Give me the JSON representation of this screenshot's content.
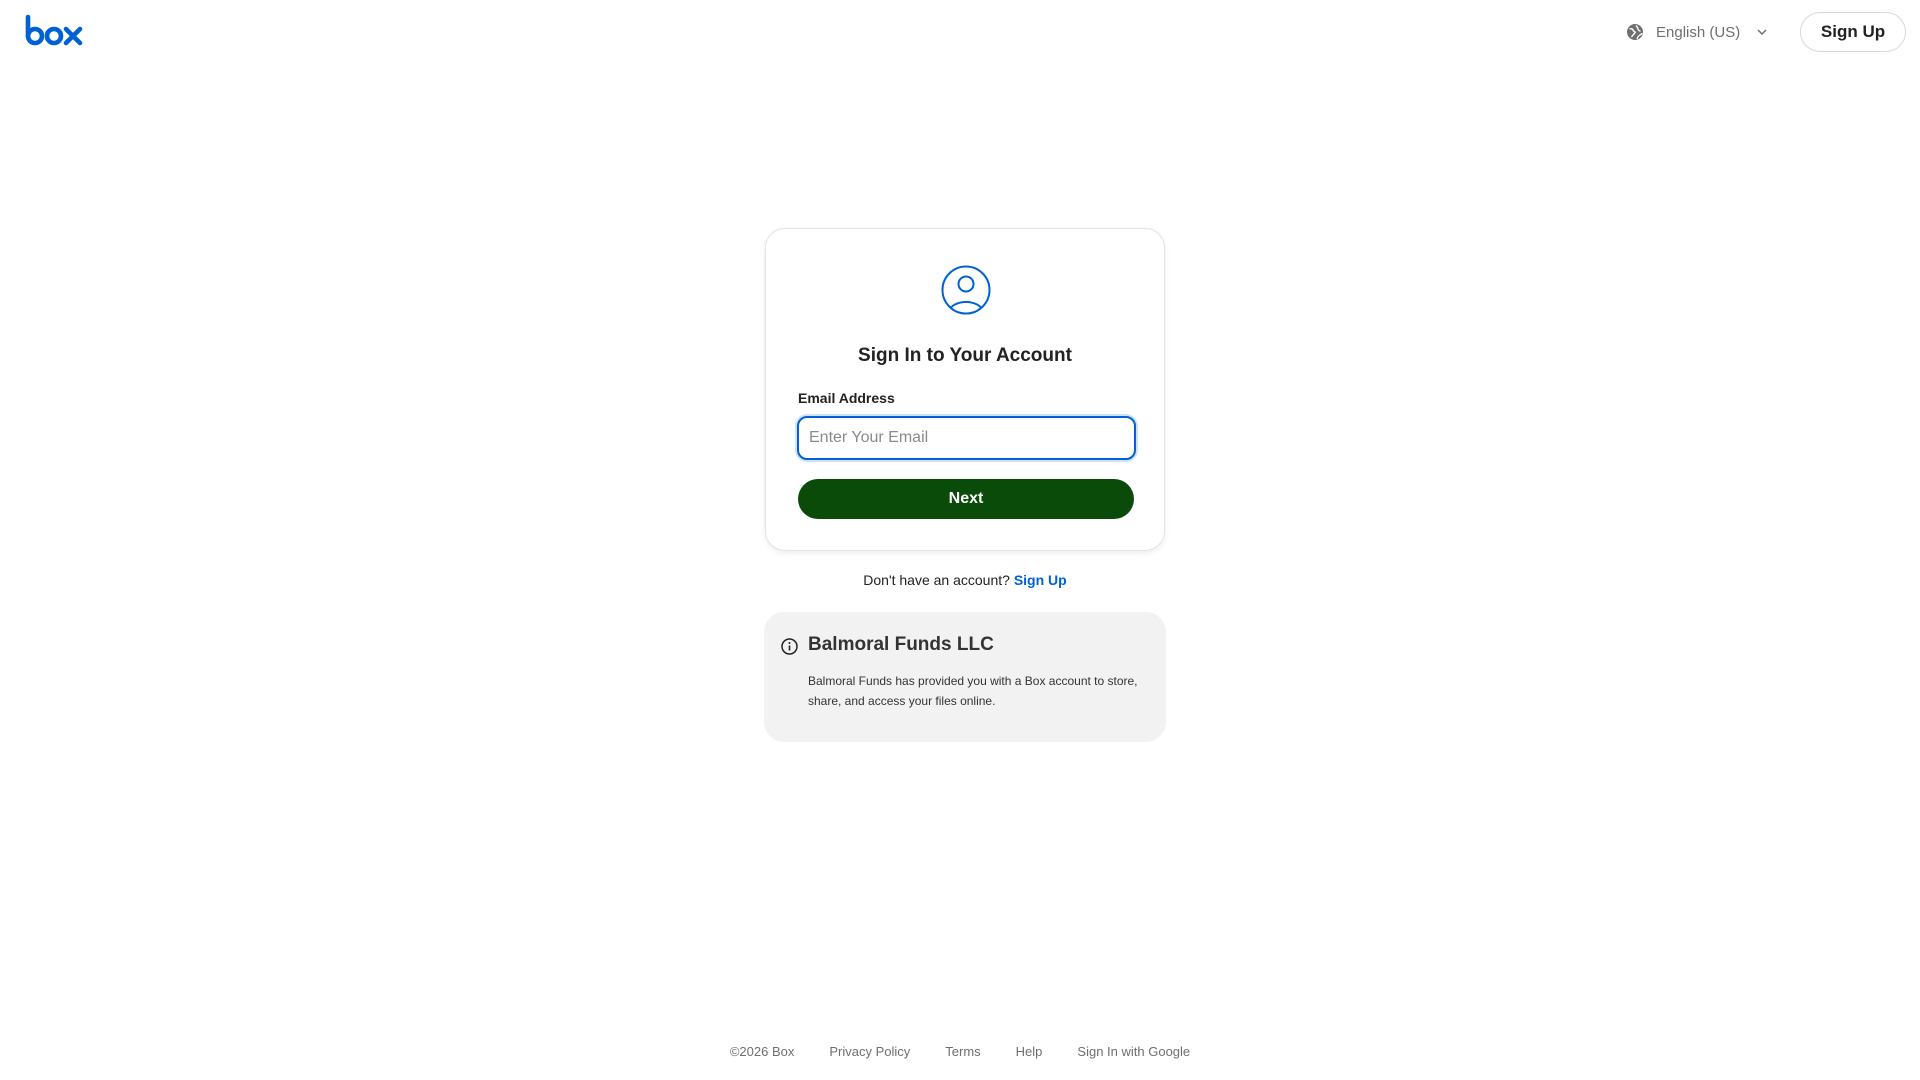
{
  "brand": {
    "name": "box",
    "logo_color": "#0061d5"
  },
  "header": {
    "language_label": "English (US)",
    "signup_label": "Sign Up"
  },
  "signin": {
    "title": "Sign In to Your Account",
    "email_label": "Email Address",
    "email_placeholder": "Enter Your Email",
    "email_value": "",
    "next_label": "Next",
    "accent": "#0061d5",
    "button_color": "#0a4b0a"
  },
  "account": {
    "prompt": "Don't have an account?",
    "signup_link": "Sign Up"
  },
  "org_info": {
    "title": "Balmoral Funds LLC",
    "description": "Balmoral Funds has provided you with a Box account to store, share, and access your files online."
  },
  "footer": {
    "copyright": "©2026 Box",
    "links": [
      "Privacy Policy",
      "Terms",
      "Help",
      "Sign In with Google"
    ]
  },
  "icons": {
    "logo": "box-logo",
    "language": "globe-icon",
    "dropdown": "chevron-down-icon",
    "avatar": "user-avatar-icon",
    "info": "info-icon"
  }
}
